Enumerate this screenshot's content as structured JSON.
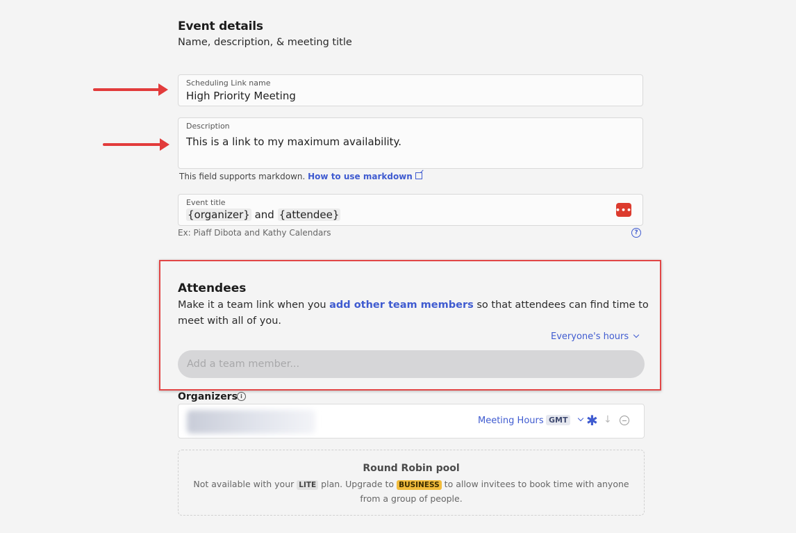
{
  "event_details": {
    "title": "Event details",
    "subtitle": "Name, description, & meeting title"
  },
  "link_name": {
    "label": "Scheduling Link name",
    "value": "High Priority Meeting"
  },
  "description": {
    "label": "Description",
    "value": "This is a link to my maximum availability.",
    "hint_text": "This field supports markdown.",
    "hint_link": "How to use markdown"
  },
  "event_title": {
    "label": "Event title",
    "token_organizer": "{organizer}",
    "joiner": "and",
    "token_attendee": "{attendee}",
    "example": "Ex: Piaff Dibota and Kathy Calendars",
    "more_button": "•••"
  },
  "attendees": {
    "title": "Attendees",
    "desc_before": "Make it a team link when you",
    "desc_link": "add other team members",
    "desc_after": "so that attendees can find time to meet with all of you.",
    "hours_select": "Everyone's hours",
    "member_placeholder": "Add a team member..."
  },
  "organizers": {
    "title": "Organizers",
    "meeting_hours": "Meeting Hours",
    "timezone": "GMT"
  },
  "round_robin": {
    "title": "Round Robin pool",
    "desc_1": "Not available with your",
    "plan_current": "LITE",
    "desc_2": "plan. Upgrade to",
    "plan_upgrade": "BUSINESS",
    "desc_3": "to allow invitees to book time with anyone from a group of people."
  },
  "colors": {
    "accent": "#3f5bd0",
    "annotation_red": "#e23b3b",
    "upgrade_badge": "#f2bc3c"
  },
  "icons": [
    "external-link-icon",
    "more-dots-icon",
    "help-icon",
    "chevron-down-icon",
    "info-icon",
    "asterisk-icon",
    "arrow-down-icon",
    "remove-icon",
    "annotation-arrow"
  ]
}
